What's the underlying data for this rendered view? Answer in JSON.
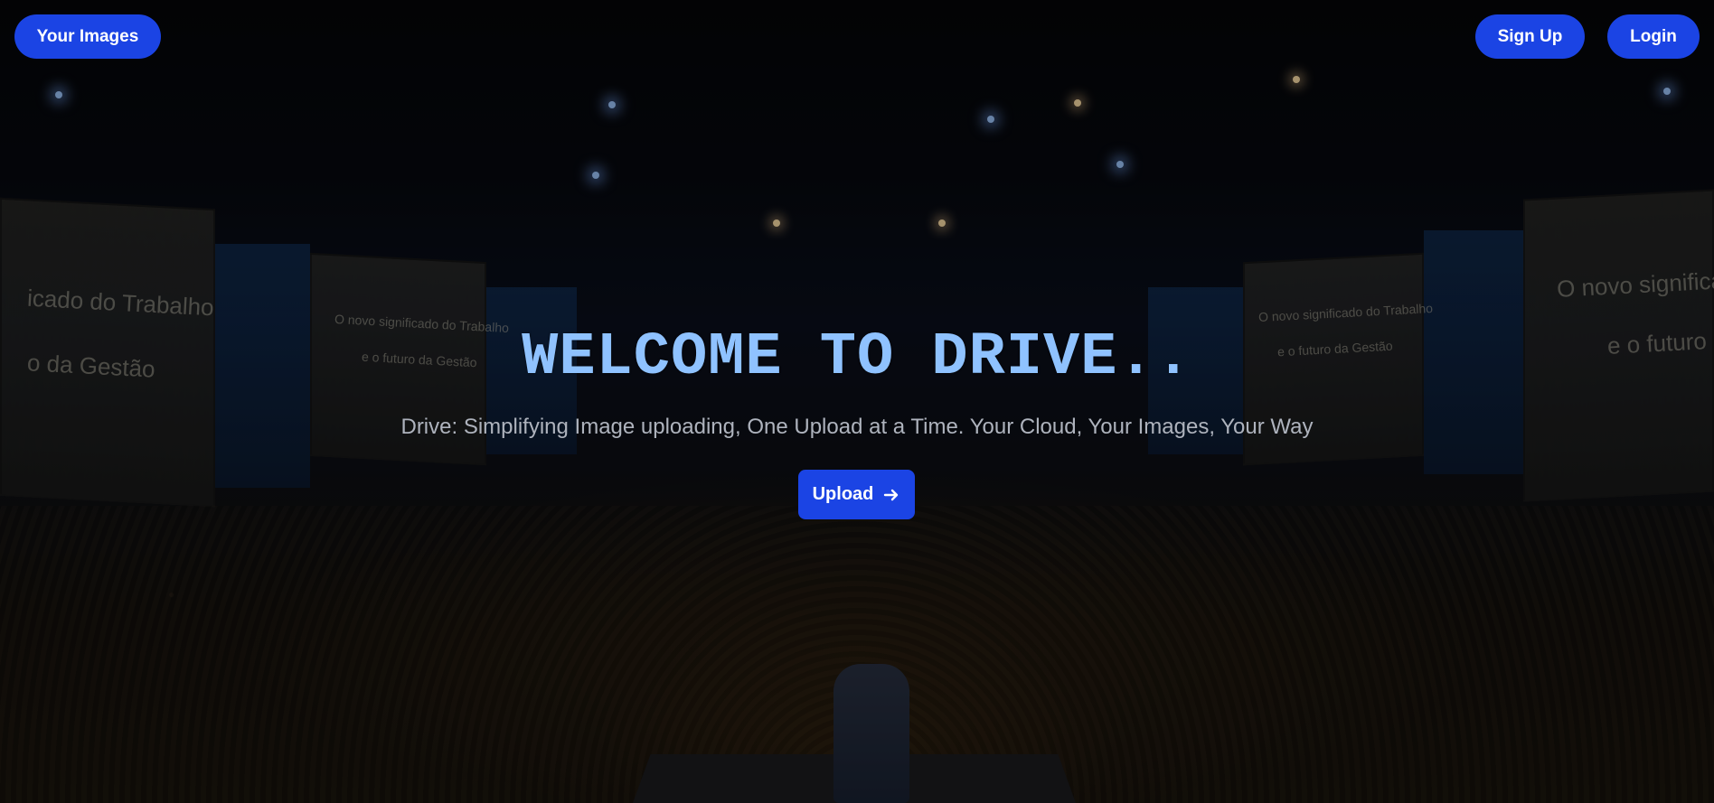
{
  "nav": {
    "your_images_label": "Your Images",
    "signup_label": "Sign Up",
    "login_label": "Login"
  },
  "hero": {
    "title": "WELCOME TO DRIVE..",
    "subtitle": "Drive: Simplifying Image uploading, One Upload at a Time. Your Cloud, Your Images, Your Way",
    "upload_label": "Upload",
    "upload_icon": "arrow-right-icon"
  },
  "background_photo": {
    "screen_left_line1": "icado do Trabalho",
    "screen_left_line2": "o da Gestão",
    "screen_center_left_line1": "O novo significado do Trabalho",
    "screen_center_left_line2": "e o futuro da Gestão",
    "screen_center_right_line1": "O novo significado do Trabalho",
    "screen_center_right_line2": "e o futuro da Gestão",
    "screen_right_line1": "O novo significa",
    "screen_right_line2": "e o futuro"
  },
  "colors": {
    "button_bg": "#1b44e4",
    "title_color": "#8fc2ff",
    "subtitle_color": "#aeb3bd",
    "page_bg": "#05060c"
  }
}
